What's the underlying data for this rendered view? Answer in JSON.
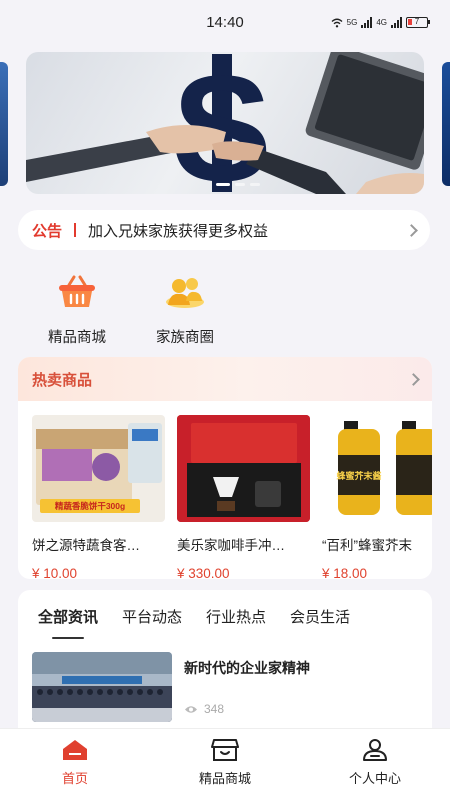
{
  "status_bar": {
    "time": "14:40",
    "battery": "7",
    "net1": "5G",
    "net2": "4G"
  },
  "notice": {
    "tag": "公告",
    "text": "加入兄妹家族获得更多权益"
  },
  "quick_entries": [
    {
      "label": "精品商城",
      "icon": "basket-icon"
    },
    {
      "label": "家族商圈",
      "icon": "people-icon"
    }
  ],
  "hot": {
    "title": "热卖商品",
    "products": [
      {
        "name": "饼之源特蔬食客…",
        "price": "¥ 10.00",
        "img_text": "精蔬香脆饼干300g"
      },
      {
        "name": "美乐家咖啡手冲…",
        "price": "¥ 330.00"
      },
      {
        "name": "“百利”蜂蜜芥末",
        "price": "¥ 18.00",
        "img_text": "蜂蜜芥末酱"
      }
    ]
  },
  "news": {
    "tabs": [
      "全部资讯",
      "平台动态",
      "行业热点",
      "会员生活"
    ],
    "active_tab": 0,
    "items": [
      {
        "title": "新时代的企业家精神",
        "views": "348"
      }
    ]
  },
  "tabbar": [
    {
      "label": "首页",
      "icon": "home-icon",
      "active": true
    },
    {
      "label": "精品商城",
      "icon": "store-icon",
      "active": false
    },
    {
      "label": "个人中心",
      "icon": "user-icon",
      "active": false
    }
  ],
  "colors": {
    "accent": "#e0402f",
    "hot_title": "#d8503a",
    "page_bg": "#f4f3f8"
  }
}
